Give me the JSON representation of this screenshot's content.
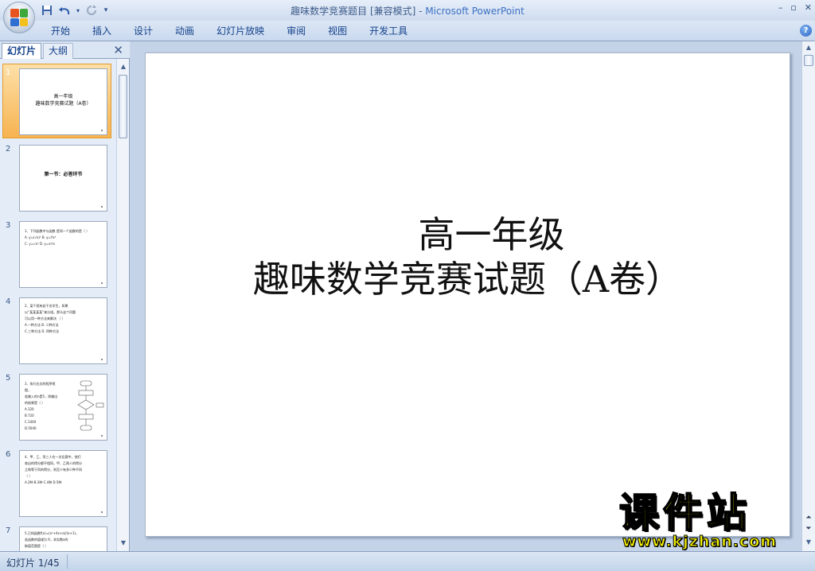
{
  "window": {
    "title": "趣味数学竞赛题目 [兼容模式] - ",
    "app_name": "Microsoft PowerPoint",
    "minimize": "–",
    "restore": "▫",
    "close": "✕"
  },
  "qat": {
    "save_icon": "save-icon",
    "undo_icon": "undo-icon",
    "redo_icon": "redo-icon",
    "customize_icon": "customize-icon"
  },
  "ribbon": {
    "tabs": [
      "开始",
      "插入",
      "设计",
      "动画",
      "幻灯片放映",
      "审阅",
      "视图",
      "开发工具"
    ],
    "help": "?"
  },
  "pane": {
    "tab_slides": "幻灯片",
    "tab_outline": "大纲",
    "close": "✕"
  },
  "thumbnails": [
    {
      "num": "1",
      "title": "高一年级\n趣味数学竞赛试题（A卷）"
    },
    {
      "num": "2",
      "title": "第一节：必答环节"
    },
    {
      "num": "3",
      "text": "1、下列函数中与函数  是同一个函数的是（ ）\nA. y=(√x)²       B. y=∛x³\nC. y=√x²          D. y=x²/x"
    },
    {
      "num": "4",
      "text": "2、某个班有若干名学生，如果\n以“某某某某”来分组，那么这个问题\n可以用一种方法来解决  （   ）\nA.一种方法      B. 二种方法\nC.三种方法      D. 四种方法"
    },
    {
      "num": "5",
      "text": "3、执行右边的程序框图，\n若输入的n是5，则输出\n的结果是（ ）\nA.120\nB.720\nC.1440\nD.5040"
    },
    {
      "num": "6",
      "text": "4、甲、乙、丙三人在一次比赛中，他们\n各自的得分都不相同，甲、乙两人的得分\n之和等于丙的得分，则至少有多少种不同\n（   ）\nA.2种    B.3种    C.4种    D.5种"
    },
    {
      "num": "7",
      "text": "5.已知函数f(x)=(x²+4x+a)/(x+1)，\n若函数的值域为 R，求实数a的\n取值范围是（   ）"
    }
  ],
  "slide": {
    "title_line1": "高一年级",
    "title_line2": "趣味数学竞赛试题（A卷）"
  },
  "status": {
    "slide_info": "幻灯片 1/45"
  },
  "watermark": {
    "logo": "课件站",
    "url": "www.kjzhan.com"
  }
}
